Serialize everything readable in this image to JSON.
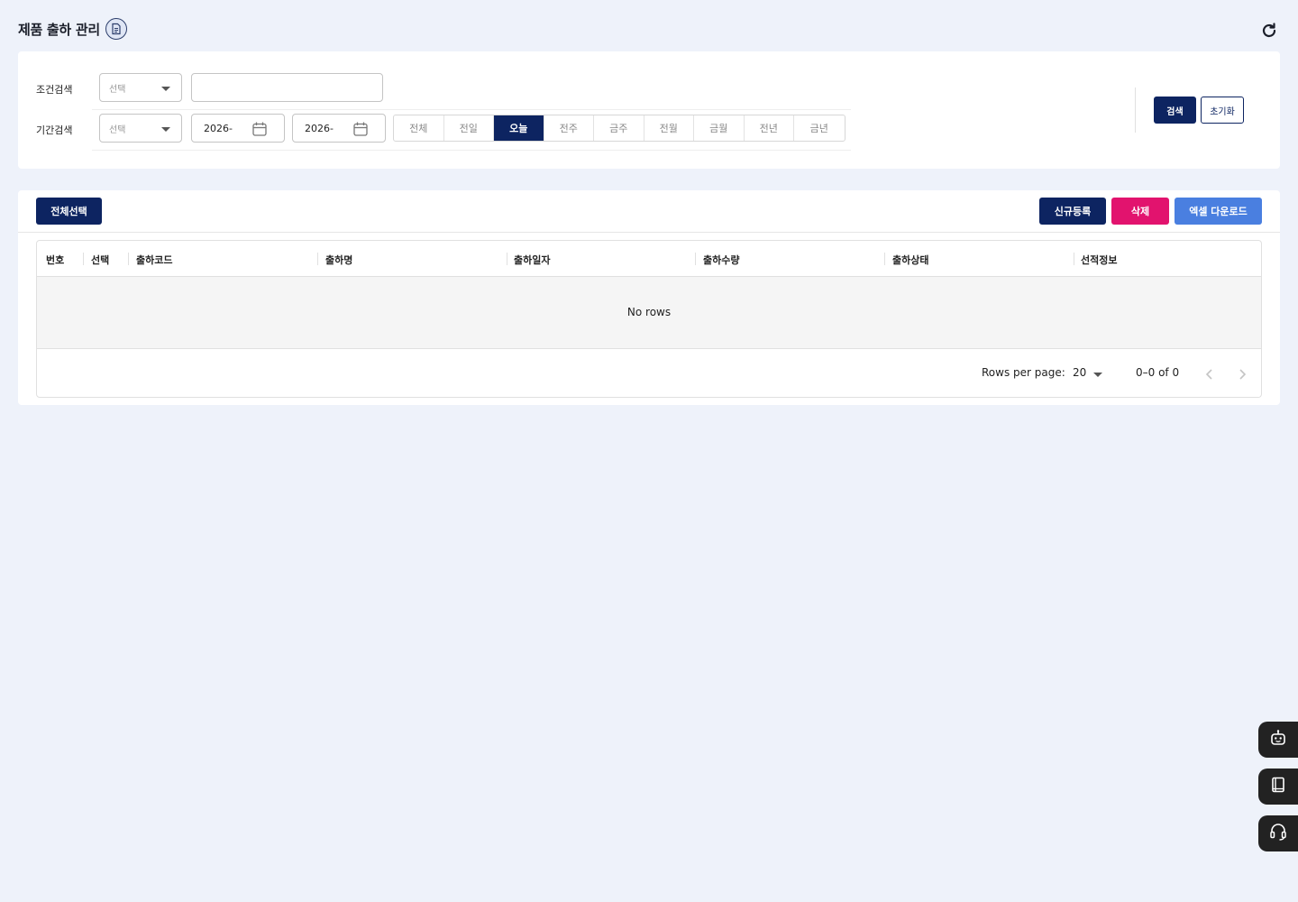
{
  "header": {
    "title": "제품 출하 관리",
    "doc_icon": "document-icon",
    "refresh_icon": "refresh-icon"
  },
  "search": {
    "condition_label": "조건검색",
    "condition_select_placeholder": "선택",
    "condition_text_value": "",
    "period_label": "기간검색",
    "period_select_placeholder": "선택",
    "date_from": "2026-",
    "date_to": "2026-",
    "period_buttons": [
      "전체",
      "전일",
      "오늘",
      "전주",
      "금주",
      "전월",
      "금월",
      "전년",
      "금년"
    ],
    "active_period": "오늘",
    "search_label": "검색",
    "reset_label": "초기화"
  },
  "toolbar": {
    "select_all_label": "전체선택",
    "new_label": "신규등록",
    "delete_label": "삭제",
    "excel_label": "엑셀 다운로드"
  },
  "table": {
    "columns": [
      "번호",
      "선택",
      "출하코드",
      "출하명",
      "출하일자",
      "출하수량",
      "출하상태",
      "선적정보"
    ],
    "empty_text": "No rows",
    "rows_per_page_label": "Rows per page:",
    "rows_per_page_value": "20",
    "page_range": "0–0 of 0"
  },
  "colors": {
    "navy": "#0d2461",
    "delete": "#e2136e",
    "excel": "#4a7fe0",
    "background": "#eef2fa"
  },
  "floating": [
    "robot-icon",
    "book-icon",
    "headset-icon"
  ]
}
